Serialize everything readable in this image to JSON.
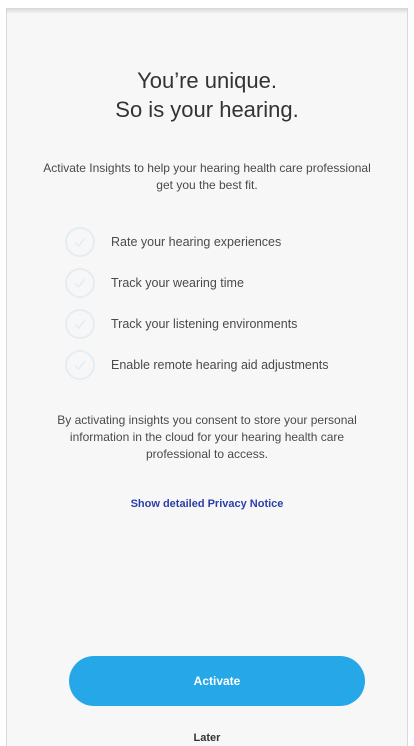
{
  "title": {
    "line1": "You’re unique.",
    "line2": "So is your hearing."
  },
  "intro": "Activate Insights to help your hearing health care professional get you the best fit.",
  "features": [
    {
      "label": "Rate your hearing experiences",
      "icon": "checkmark-icon"
    },
    {
      "label": "Track your wearing time",
      "icon": "checkmark-icon"
    },
    {
      "label": "Track your listening environments",
      "icon": "checkmark-icon"
    },
    {
      "label": "Enable remote hearing aid adjustments",
      "icon": "checkmark-icon"
    }
  ],
  "consent": "By activating insights you consent to store your personal information in the cloud for your hearing health care professional to access.",
  "privacy_link": "Show detailed Privacy Notice",
  "actions": {
    "activate_label": "Activate",
    "later_label": "Later"
  },
  "colors": {
    "accent": "#26a8e8",
    "link": "#2b3fa8",
    "check_ring": "#e4edf4"
  }
}
